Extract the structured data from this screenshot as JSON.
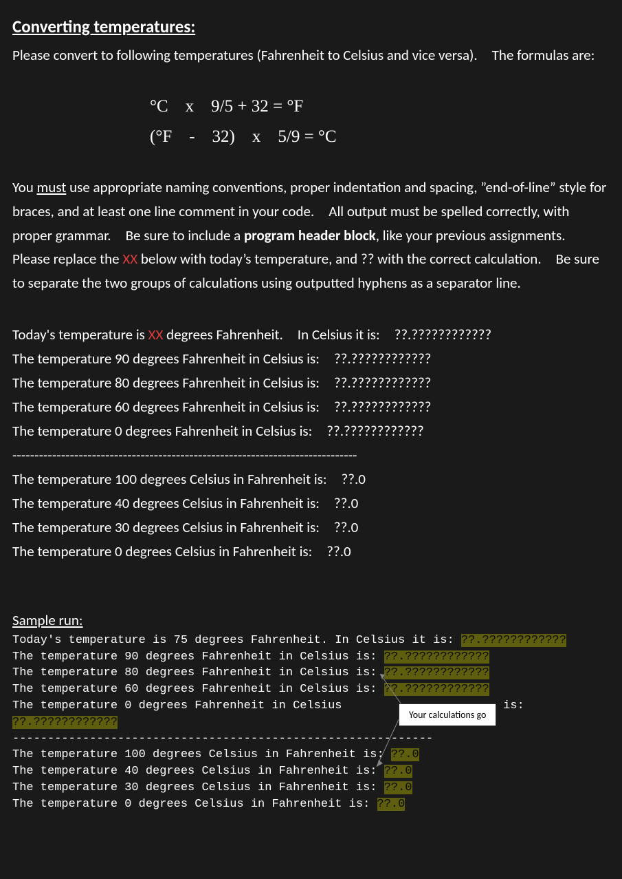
{
  "heading": "Converting temperatures:",
  "intro": "Please convert to following temperatures (Fahrenheit to Celsius and vice versa). The formulas are:",
  "formula1": "°C x 9/5 + 32 = °F",
  "formula2": "(°F - 32) x 5/9 = °C",
  "p2_a": "You ",
  "p2_must": "must",
  "p2_b": " use appropriate naming conventions, proper indentation and spacing, ”end-of-line” style for braces, and at least one line comment in your code. All output must be spelled correctly, with proper grammar. Be sure to include a ",
  "p2_bold": "program header block",
  "p2_c": ", like your previous assignments. Please replace the ",
  "p2_xx": "XX",
  "p2_d": " below with today’s temperature, and ?? with the correct calculation. Be sure to separate the two groups of calculations using outputted hyphens as a separator line.",
  "out1_a": "Today's temperature is ",
  "out1_xx": "XX",
  "out1_b": " degrees Fahrenheit. In Celsius it is: ??.????????????",
  "out2": "The temperature 90 degrees Fahrenheit in Celsius is: ??.????????????",
  "out3": "The temperature 80 degrees Fahrenheit in Celsius is: ??.????????????",
  "out4": "The temperature 60 degrees Fahrenheit in Celsius is: ??.????????????",
  "out5": "The temperature 0 degrees Fahrenheit in Celsius is: ??.????????????",
  "sep": "------------------------------------------------------------------------------",
  "out6": "The temperature 100 degrees Celsius in Fahrenheit is: ??.0",
  "out7": "The temperature 40 degrees Celsius in Fahrenheit is: ??.0",
  "out8": "The temperature 30 degrees Celsius in Fahrenheit is: ??.0",
  "out9": "The temperature 0 degrees Celsius in Fahrenheit is: ??.0",
  "sample_heading": "Sample run:",
  "s1_a": "Today's temperature is 75 degrees Fahrenheit. In Celsius it is: ",
  "s1_h": "??.????????????",
  "s2_a": "The temperature 90 degrees Fahrenheit in Celsius is: ",
  "s2_h": "??.????????????",
  "s3_a": "The temperature 80 degrees Fahrenheit in Celsius is: ",
  "s3_h": "??.????????????",
  "s4_a": "The temperature 60 degrees Fahrenheit in Celsius is: ",
  "s4_h": "??.????????????",
  "s5_a": "The temperature  0 degrees Fahrenheit in Celsius",
  "s5_gap": "                       ",
  "s5_b": "is: ",
  "s5_h": "??.????????????",
  "sample_sep": "------------------------------------------------------------",
  "s6_a": "The temperature 100 degrees Celsius in Fahrenheit is: ",
  "s6_h": "??.0",
  "s7_a": "The temperature 40 degrees Celsius in Fahrenheit is: ",
  "s7_h": "??.0",
  "s8_a": "The temperature 30 degrees Celsius in Fahrenheit is: ",
  "s8_h": "??.0",
  "s9_a": "The temperature 0 degrees Celsius in Fahrenheit is: ",
  "s9_h": "??.0",
  "callout": "Your calculations go"
}
